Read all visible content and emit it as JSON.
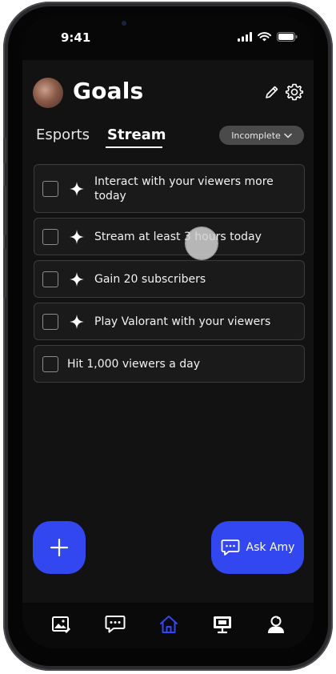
{
  "status_bar": {
    "time": "9:41"
  },
  "header": {
    "title": "Goals"
  },
  "tabs": [
    {
      "label": "Esports"
    },
    {
      "label": "Stream"
    }
  ],
  "filter": {
    "selected": "Incomplete"
  },
  "goals": [
    {
      "text_line1": "Interact with your viewers more",
      "text_line2": "today"
    },
    {
      "text": "Stream at least 3 hours today"
    },
    {
      "text": "Gain 20 subscribers"
    },
    {
      "text": "Play Valorant with your viewers"
    },
    {
      "text": "Hit 1,000 viewers a day"
    }
  ],
  "ask_button": {
    "label": "Ask Amy"
  },
  "colors": {
    "accent": "#3347f0",
    "active_nav": "#3347f0"
  },
  "bottom_nav": [
    {
      "icon": "gallery-icon"
    },
    {
      "icon": "chat-icon"
    },
    {
      "icon": "home-icon",
      "active": true
    },
    {
      "icon": "monitor-icon"
    },
    {
      "icon": "profile-icon"
    }
  ]
}
